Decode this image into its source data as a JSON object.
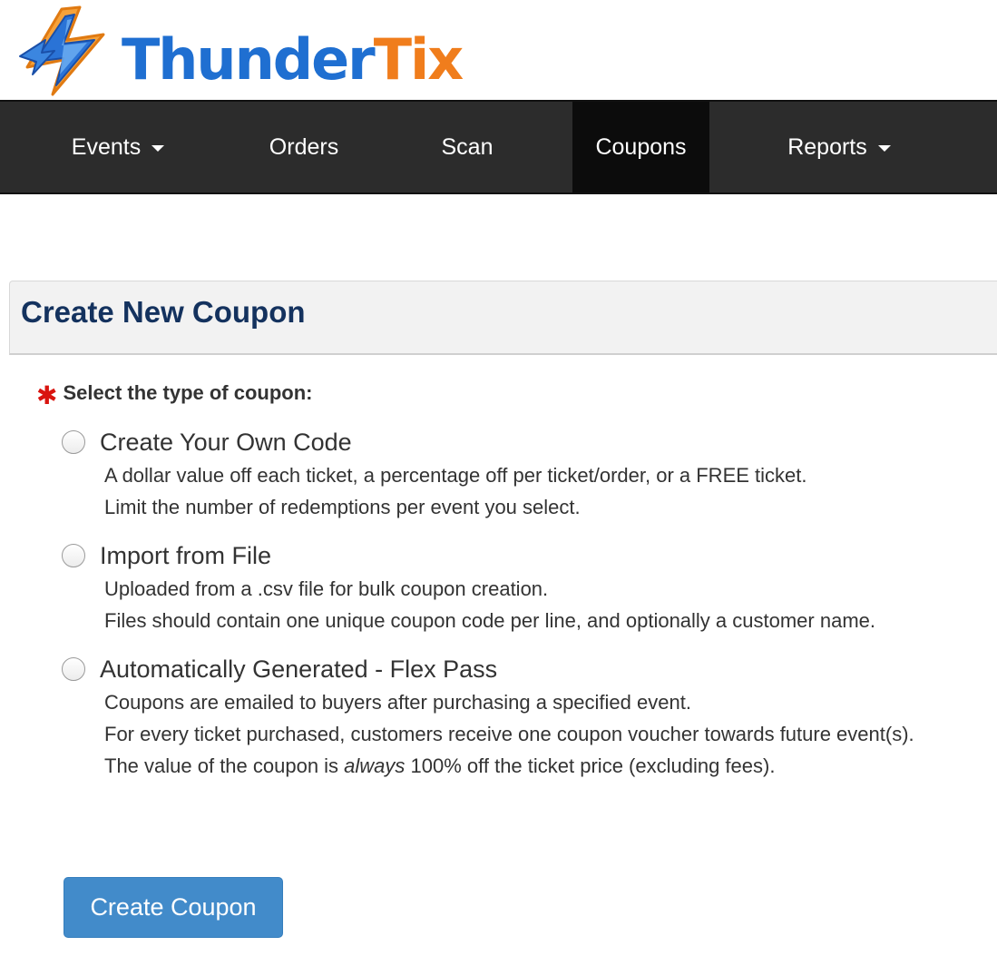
{
  "brand": {
    "logo_part_a": "Thunder",
    "logo_part_b": "Tix",
    "color_blue": "#1f6fd1",
    "color_orange": "#f07d1c"
  },
  "nav": {
    "items": [
      {
        "label": "Events",
        "has_dropdown": true
      },
      {
        "label": "Orders",
        "has_dropdown": false
      },
      {
        "label": "Scan",
        "has_dropdown": false
      },
      {
        "label": "Coupons",
        "has_dropdown": false,
        "active": true
      },
      {
        "label": "Reports",
        "has_dropdown": true
      }
    ]
  },
  "panel": {
    "title": "Create New Coupon"
  },
  "form": {
    "required_marker": "✱",
    "question": "Select the type of coupon:",
    "options": [
      {
        "title": "Create Your Own Code",
        "selected": false,
        "lines": [
          "A dollar value off each ticket, a percentage off per ticket/order, or a FREE ticket.",
          "Limit the number of redemptions per event you select."
        ]
      },
      {
        "title": "Import from File",
        "selected": false,
        "lines": [
          "Uploaded from a .csv file for bulk coupon creation.",
          "Files should contain one unique coupon code per line, and optionally a customer name."
        ]
      },
      {
        "title": "Automatically Generated - Flex Pass",
        "selected": false,
        "lines": [
          "Coupons are emailed to buyers after purchasing a specified event.",
          "For every ticket purchased, customers receive one coupon voucher towards future event(s)."
        ],
        "line3_before": "The value of the coupon is ",
        "line3_emphasis": "always",
        "line3_after": " 100% off the ticket price (excluding fees)."
      }
    ],
    "submit_label": "Create Coupon"
  }
}
